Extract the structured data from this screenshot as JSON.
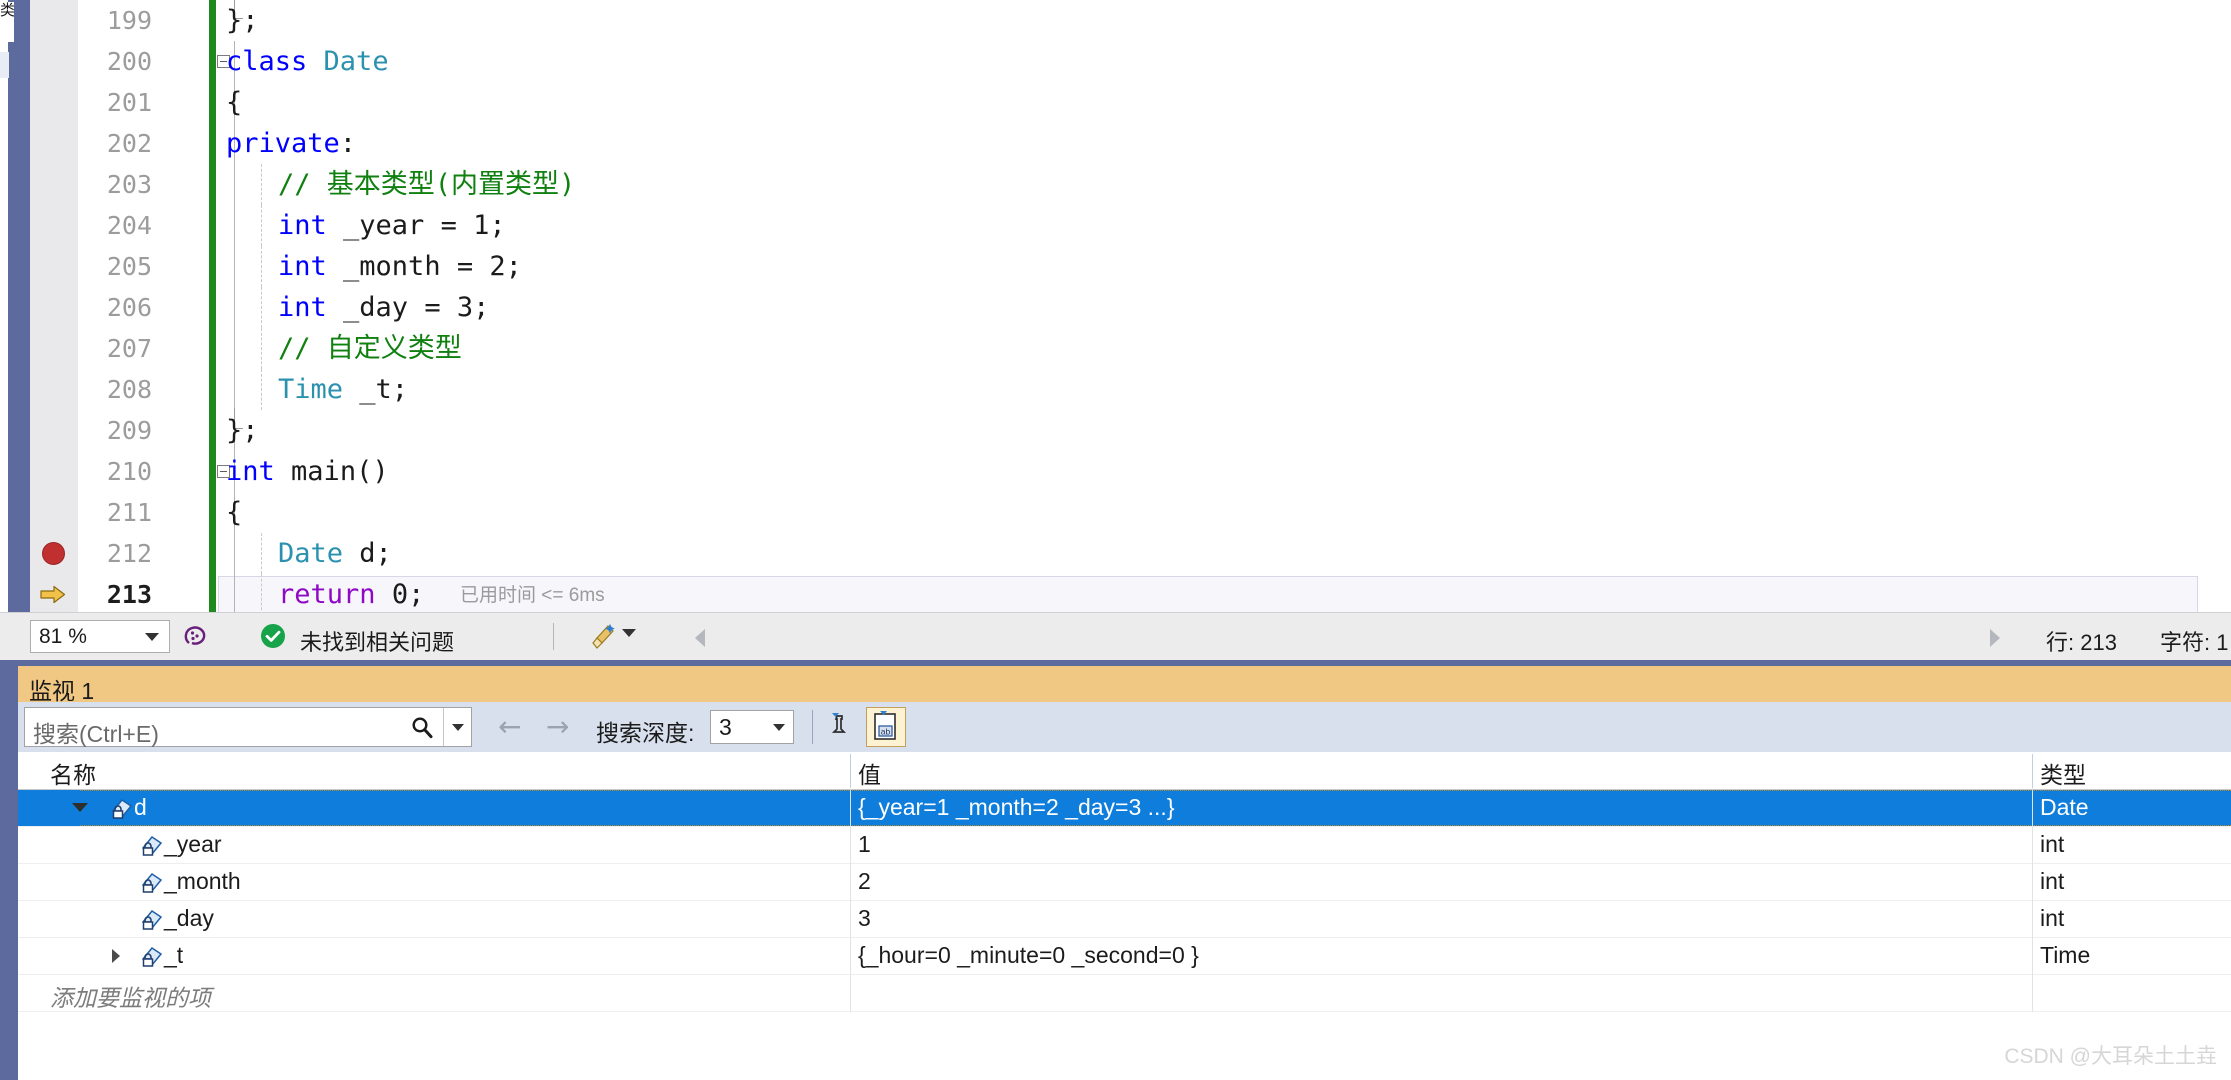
{
  "left_strip": {
    "tab_label": "类"
  },
  "editor": {
    "lines": [
      {
        "num": "199",
        "indent": 0,
        "tokens": [
          {
            "t": "};",
            "c": "plain"
          }
        ]
      },
      {
        "num": "200",
        "indent": 0,
        "collapse": true,
        "tokens": [
          {
            "t": "class ",
            "c": "kw"
          },
          {
            "t": "Date",
            "c": "typ"
          }
        ]
      },
      {
        "num": "201",
        "indent": 0,
        "tokens": [
          {
            "t": "{",
            "c": "plain"
          }
        ]
      },
      {
        "num": "202",
        "indent": 0,
        "tokens": [
          {
            "t": "private",
            "c": "kw"
          },
          {
            "t": ":",
            "c": "plain"
          }
        ]
      },
      {
        "num": "203",
        "indent": 1,
        "tokens": [
          {
            "t": "// 基本类型(内置类型)",
            "c": "cmt"
          }
        ]
      },
      {
        "num": "204",
        "indent": 1,
        "tokens": [
          {
            "t": "int",
            "c": "kw"
          },
          {
            "t": " _year = ",
            "c": "plain"
          },
          {
            "t": "1",
            "c": "num"
          },
          {
            "t": ";",
            "c": "plain"
          }
        ]
      },
      {
        "num": "205",
        "indent": 1,
        "tokens": [
          {
            "t": "int",
            "c": "kw"
          },
          {
            "t": " _month = ",
            "c": "plain"
          },
          {
            "t": "2",
            "c": "num"
          },
          {
            "t": ";",
            "c": "plain"
          }
        ]
      },
      {
        "num": "206",
        "indent": 1,
        "tokens": [
          {
            "t": "int",
            "c": "kw"
          },
          {
            "t": " _day = ",
            "c": "plain"
          },
          {
            "t": "3",
            "c": "num"
          },
          {
            "t": ";",
            "c": "plain"
          }
        ]
      },
      {
        "num": "207",
        "indent": 1,
        "tokens": [
          {
            "t": "// 自定义类型",
            "c": "cmt"
          }
        ]
      },
      {
        "num": "208",
        "indent": 1,
        "tokens": [
          {
            "t": "Time",
            "c": "typ"
          },
          {
            "t": " _t;",
            "c": "plain"
          }
        ]
      },
      {
        "num": "209",
        "indent": 0,
        "tokens": [
          {
            "t": "};",
            "c": "plain"
          }
        ]
      },
      {
        "num": "210",
        "indent": 0,
        "collapse": true,
        "tokens": [
          {
            "t": "int",
            "c": "kw"
          },
          {
            "t": " ",
            "c": "plain"
          },
          {
            "t": "main",
            "c": "plain"
          },
          {
            "t": "()",
            "c": "plain"
          }
        ]
      },
      {
        "num": "211",
        "indent": 0,
        "tokens": [
          {
            "t": "{",
            "c": "plain"
          }
        ]
      },
      {
        "num": "212",
        "indent": 1,
        "breakpoint": true,
        "tokens": [
          {
            "t": "Date",
            "c": "typ"
          },
          {
            "t": " d;",
            "c": "plain"
          }
        ]
      },
      {
        "num": "213",
        "indent": 1,
        "current": true,
        "tokens": [
          {
            "t": "return",
            "c": "ctl"
          },
          {
            "t": " ",
            "c": "plain"
          },
          {
            "t": "0",
            "c": "num"
          },
          {
            "t": ";",
            "c": "plain"
          }
        ],
        "elapsed": "已用时间 <= 6ms"
      }
    ]
  },
  "statusbar": {
    "zoom_value": "81 %",
    "problems_text": "未找到相关问题",
    "line_label": "行: 213",
    "char_label": "字符: 1"
  },
  "watch_panel": {
    "title": "监视 1",
    "search_placeholder": "搜索(Ctrl+E)",
    "search_value": "",
    "depth_label": "搜索深度:",
    "depth_value": "3",
    "columns": [
      "名称",
      "值",
      "类型"
    ],
    "rows": [
      {
        "name": "d",
        "value": "{_year=1 _month=2 _day=3 ...}",
        "type": "Date",
        "level": 0,
        "expander": "open",
        "selected": true
      },
      {
        "name": "_year",
        "value": "1",
        "type": "int",
        "level": 1,
        "expander": "none",
        "selected": false
      },
      {
        "name": "_month",
        "value": "2",
        "type": "int",
        "level": 1,
        "expander": "none",
        "selected": false
      },
      {
        "name": "_day",
        "value": "3",
        "type": "int",
        "level": 1,
        "expander": "none",
        "selected": false
      },
      {
        "name": "_t",
        "value": "{_hour=0 _minute=0 _second=0 }",
        "type": "Time",
        "level": 1,
        "expander": "closed",
        "selected": false
      }
    ],
    "add_item_text": "添加要监视的项"
  },
  "watermark": "CSDN @大耳朵土土垚",
  "colors": {
    "dock_frame": "#5c6a9e",
    "title_bar": "#f0c884",
    "toolbar": "#d8e0ee",
    "selection": "#0f7ddb",
    "keyword": "#0000ff",
    "type": "#2b91af",
    "comment": "#108010",
    "control": "#8f08c4",
    "changebar": "#1e8a1e",
    "breakpoint": "#c03030",
    "step_arrow": "#f2c14a"
  }
}
